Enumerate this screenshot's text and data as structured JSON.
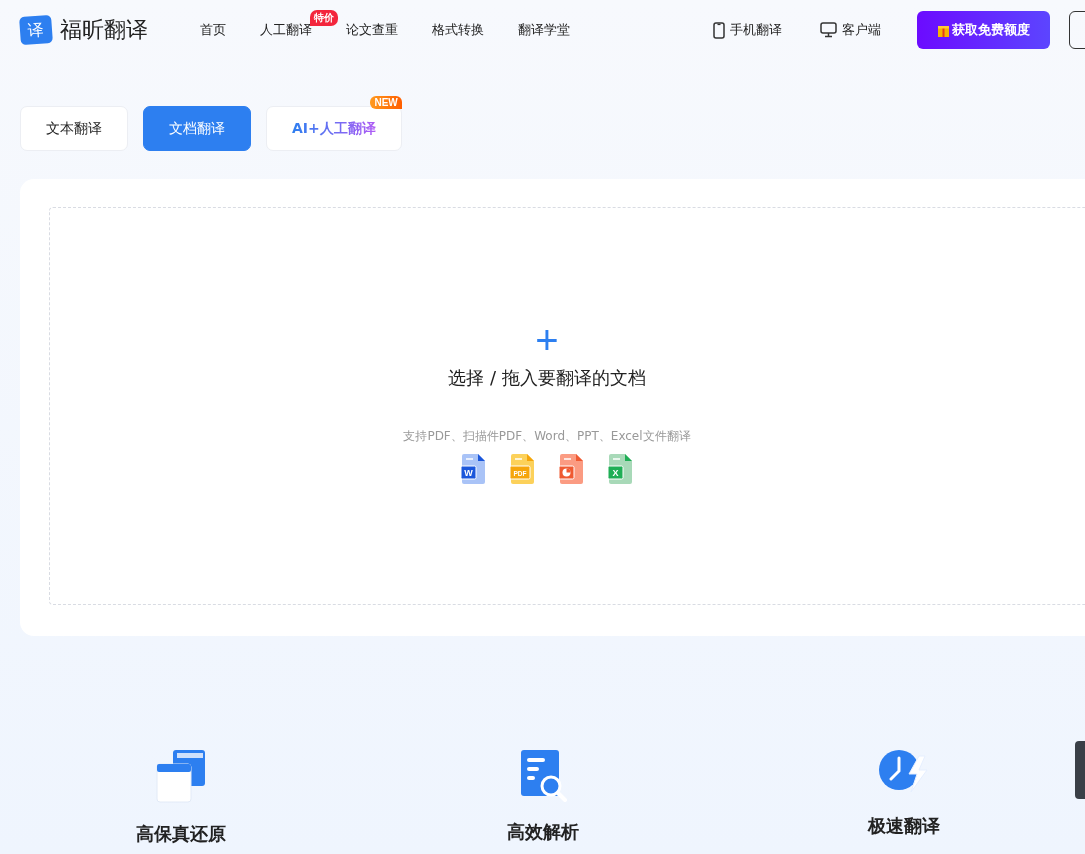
{
  "logo": {
    "mark": "译",
    "name": "福昕翻译"
  },
  "nav": [
    {
      "label": "首页"
    },
    {
      "label": "人工翻译",
      "badge": "特价"
    },
    {
      "label": "论文查重"
    },
    {
      "label": "格式转换"
    },
    {
      "label": "翻译学堂"
    }
  ],
  "header_links": [
    {
      "kind": "phone",
      "label": "手机翻译"
    },
    {
      "kind": "desktop",
      "label": "客户端"
    }
  ],
  "promo_button": {
    "label": "获取免费额度"
  },
  "mode_tabs": [
    {
      "label": "文本翻译",
      "selected": false
    },
    {
      "label": "文档翻译",
      "selected": true
    },
    {
      "label": "AI+人工翻译",
      "selected": false,
      "badge": "NEW",
      "kind": "gradient"
    }
  ],
  "upload": {
    "plus": "+",
    "title": "选择 / 拖入要翻译的文档",
    "hint": "支持PDF、扫描件PDF、Word、PPT、Excel文件翻译",
    "file_types": [
      {
        "kind": "word",
        "label": "W"
      },
      {
        "kind": "pdf",
        "label": "PDF"
      },
      {
        "kind": "ppt"
      },
      {
        "kind": "excel",
        "label": "X"
      }
    ]
  },
  "features": [
    {
      "kind": "layout",
      "title": "高保真还原"
    },
    {
      "kind": "parse",
      "title": "高效解析"
    },
    {
      "kind": "speed",
      "title": "极速翻译"
    }
  ]
}
